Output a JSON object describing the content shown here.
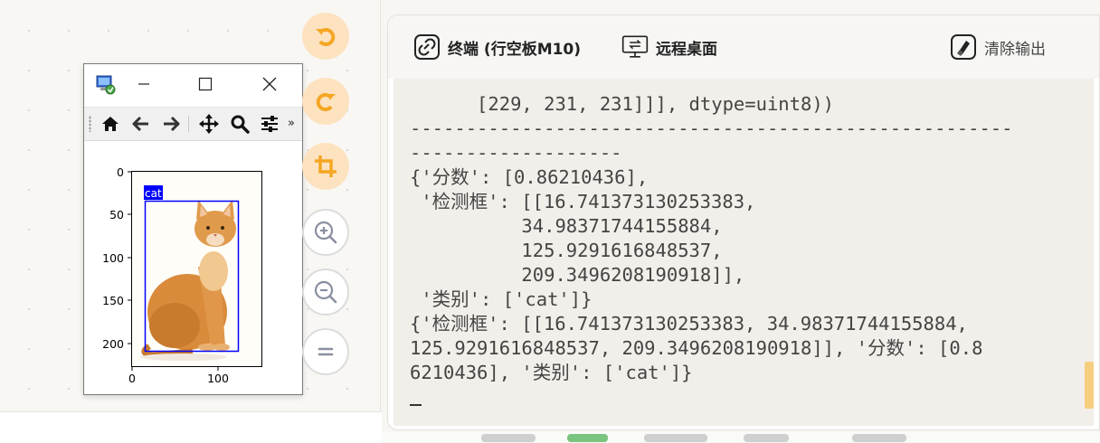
{
  "figure_window": {
    "toolbar": {
      "home": "home-icon",
      "back": "arrow-left-icon",
      "forward": "arrow-right-icon",
      "pan": "move-icon",
      "zoom": "magnifier-icon",
      "configure": "sliders-icon",
      "more": "»"
    },
    "plot": {
      "yticks": [
        "0",
        "50",
        "100",
        "150",
        "200"
      ],
      "xticks": [
        "0",
        "100"
      ],
      "box_label": "cat"
    }
  },
  "side_tools": [
    {
      "name": "undo-button",
      "icon": "undo-icon"
    },
    {
      "name": "redo-button",
      "icon": "redo-icon"
    },
    {
      "name": "crop-button",
      "icon": "crop-icon"
    },
    {
      "name": "zoom-in-button",
      "icon": "zoom-in-icon"
    },
    {
      "name": "zoom-out-button",
      "icon": "zoom-out-icon"
    },
    {
      "name": "reset-zoom-button",
      "icon": "equals-icon"
    }
  ],
  "panel": {
    "tabs": {
      "terminal": "终端 (行空板M10)",
      "remote": "远程桌面",
      "clear": "清除输出"
    },
    "terminal_lines": [
      "      [229, 231, 231]]], dtype=uint8))",
      "------------------------------------------------------",
      "-------------------",
      "{'分数': [0.86210436],",
      " '检测框': [[16.741373130253383,",
      "          34.98371744155884,",
      "          125.9291616848537,",
      "          209.3496208190918]],",
      " '类别': ['cat']}",
      "{'检测框': [[16.741373130253383, 34.98371744155884,",
      "125.9291616848537, 209.3496208190918]], '分数': [0.8",
      "6210436], '类别': ['cat']}"
    ]
  },
  "colors": {
    "accent_orange": "#f5a623",
    "bbox_blue": "#0000ff",
    "cat_orange": "#d98a3a"
  }
}
